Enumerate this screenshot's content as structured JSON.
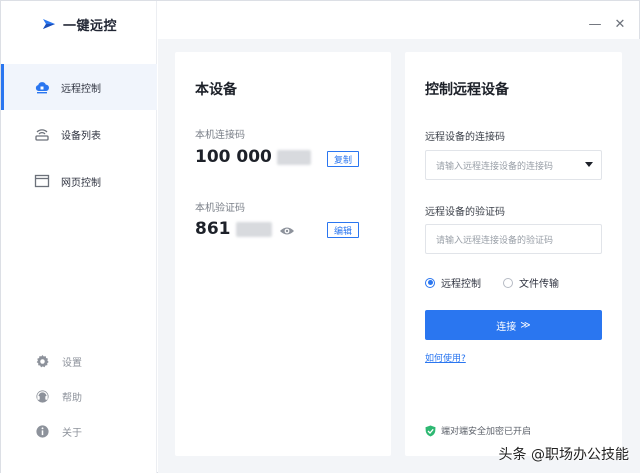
{
  "app": {
    "title": "一键远控"
  },
  "sidebar": {
    "items": [
      {
        "label": "远程控制",
        "icon": "cloud-remote-icon",
        "active": true
      },
      {
        "label": "设备列表",
        "icon": "device-list-icon",
        "active": false
      },
      {
        "label": "网页控制",
        "icon": "browser-window-icon",
        "active": false
      }
    ],
    "footer": [
      {
        "label": "设置",
        "icon": "gear-icon"
      },
      {
        "label": "帮助",
        "icon": "help-icon"
      },
      {
        "label": "关于",
        "icon": "info-icon"
      }
    ]
  },
  "window_controls": {
    "minimize": "—",
    "close": "✕"
  },
  "this_device": {
    "title": "本设备",
    "connect_code_label": "本机连接码",
    "connect_code": "100 000",
    "copy_label": "复制",
    "verify_code_label": "本机验证码",
    "verify_code": "861",
    "edit_label": "编辑"
  },
  "remote": {
    "title": "控制远程设备",
    "connect_code_label": "远程设备的连接码",
    "connect_code_placeholder": "请输入远程连接设备的连接码",
    "verify_code_label": "远程设备的验证码",
    "verify_code_placeholder": "请输入远程连接设备的验证码",
    "modes": [
      {
        "label": "远程控制",
        "selected": true
      },
      {
        "label": "文件传输",
        "selected": false
      }
    ],
    "connect_label": "连接",
    "connect_arrow": "≫",
    "help_link": "如何使用?",
    "secure_text": "端对端安全加密已开启"
  },
  "watermark": {
    "text": "头条 @职场办公技能"
  },
  "colors": {
    "accent": "#2a76f0",
    "sidebar_active_bg": "#f1f5fc",
    "main_bg": "#f3f5f8",
    "secure_green": "#2eb872"
  }
}
